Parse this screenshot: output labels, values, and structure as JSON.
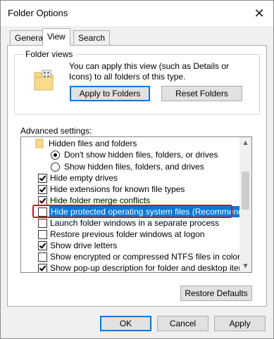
{
  "window": {
    "title": "Folder Options",
    "close_glyph": "✕"
  },
  "tabs": [
    {
      "label": "General"
    },
    {
      "label": "View"
    },
    {
      "label": "Search"
    }
  ],
  "folder_views": {
    "title": "Folder views",
    "description": "You can apply this view (such as Details or Icons) to all folders of this type.",
    "apply_button": "Apply to Folders",
    "reset_button": "Reset Folders"
  },
  "advanced": {
    "label": "Advanced settings:",
    "items": [
      {
        "kind": "folder",
        "label": "Hidden files and folders"
      },
      {
        "kind": "radio",
        "checked": true,
        "label": "Don't show hidden files, folders, or drives"
      },
      {
        "kind": "radio",
        "checked": false,
        "label": "Show hidden files, folders, and drives"
      },
      {
        "kind": "checkbox",
        "checked": true,
        "label": "Hide empty drives"
      },
      {
        "kind": "checkbox",
        "checked": true,
        "label": "Hide extensions for known file types"
      },
      {
        "kind": "checkbox",
        "checked": true,
        "label": "Hide folder merge conflicts"
      },
      {
        "kind": "checkbox",
        "checked": false,
        "selected": true,
        "label": "Hide protected operating system files (Recommended)"
      },
      {
        "kind": "checkbox",
        "checked": false,
        "label": "Launch folder windows in a separate process"
      },
      {
        "kind": "checkbox",
        "checked": false,
        "label": "Restore previous folder windows at logon"
      },
      {
        "kind": "checkbox",
        "checked": true,
        "label": "Show drive letters"
      },
      {
        "kind": "checkbox",
        "checked": false,
        "label": "Show encrypted or compressed NTFS files in color"
      },
      {
        "kind": "checkbox",
        "checked": true,
        "label": "Show pop-up description for folder and desktop items"
      }
    ]
  },
  "restore_defaults": "Restore Defaults",
  "footer": {
    "ok": "OK",
    "cancel": "Cancel",
    "apply": "Apply"
  },
  "colors": {
    "selection": "#0078d7",
    "callout": "#d0161c",
    "accent": "#0078d7"
  }
}
